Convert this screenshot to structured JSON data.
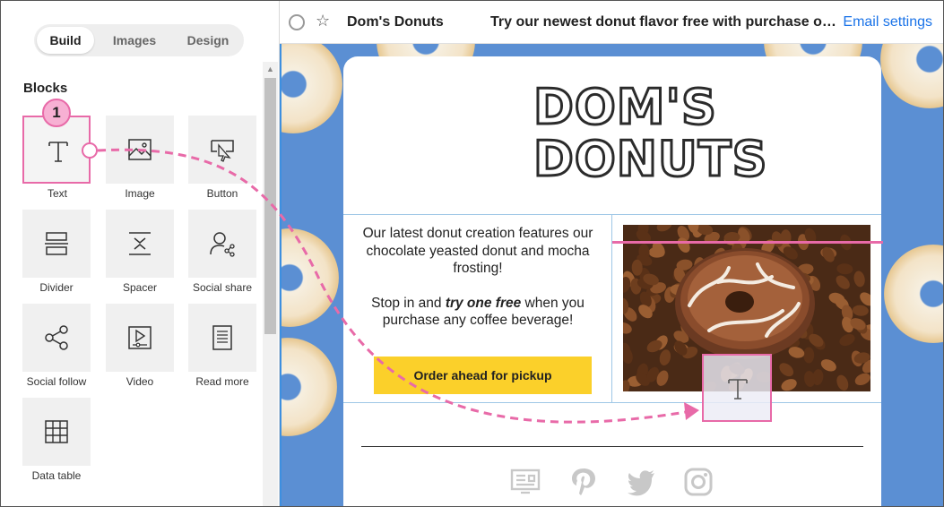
{
  "sidebar": {
    "tabs": [
      {
        "label": "Build",
        "active": true
      },
      {
        "label": "Images",
        "active": false
      },
      {
        "label": "Design",
        "active": false
      }
    ],
    "blocks_title": "Blocks",
    "blocks": [
      {
        "label": "Text",
        "icon": "text-icon"
      },
      {
        "label": "Image",
        "icon": "image-icon"
      },
      {
        "label": "Button",
        "icon": "button-cursor-icon"
      },
      {
        "label": "Divider",
        "icon": "divider-icon"
      },
      {
        "label": "Spacer",
        "icon": "spacer-icon"
      },
      {
        "label": "Social share",
        "icon": "social-share-icon"
      },
      {
        "label": "Social follow",
        "icon": "social-follow-icon"
      },
      {
        "label": "Video",
        "icon": "video-icon"
      },
      {
        "label": "Read more",
        "icon": "read-more-icon"
      },
      {
        "label": "Data table",
        "icon": "data-table-icon"
      }
    ],
    "step_badge": "1"
  },
  "header": {
    "sender": "Dom's Donuts",
    "subject": "Try our newest donut flavor free with purchase of any coffee beverage!",
    "settings_link": "Email settings"
  },
  "email": {
    "logo_line1": "DOM'S",
    "logo_line2": "DONUTS",
    "body_p1": "Our latest donut creation features our chocolate yeasted donut and mocha frosting!",
    "body_p2_before": "Stop in and ",
    "body_p2_emphasis": "try one free",
    "body_p2_after": " when you purchase any coffee beverage!",
    "cta_label": "Order ahead for pickup",
    "social_icons": [
      "website-icon",
      "pinterest-icon",
      "twitter-icon",
      "instagram-icon"
    ]
  },
  "colors": {
    "accent_pink": "#e86aa8",
    "background_blue": "#5b8fd3",
    "cta_yellow": "#fbd02a",
    "link_blue": "#1a73e8"
  }
}
